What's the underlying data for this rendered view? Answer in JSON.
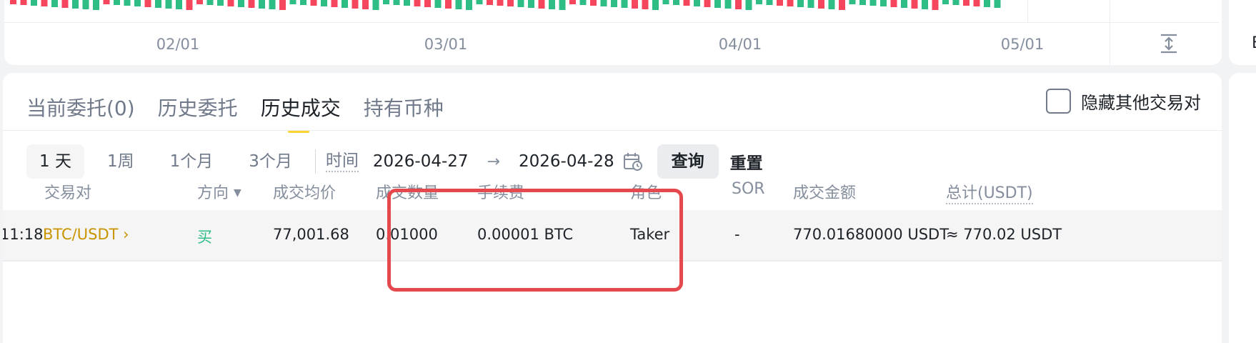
{
  "colors": {
    "up": "#2ebd85",
    "down": "#f6465d",
    "accent": "#fcd535",
    "pair_link": "#c99400",
    "highlight": "#e5484d"
  },
  "chart": {
    "x_ticks": [
      "02/01",
      "03/01",
      "04/01",
      "05/01"
    ],
    "expand_icon": "expand-vertical-icon"
  },
  "tabs": [
    {
      "label": "当前委托(0)",
      "active": false
    },
    {
      "label": "历史委托",
      "active": false
    },
    {
      "label": "历史成交",
      "active": true
    },
    {
      "label": "持有币种",
      "active": false
    }
  ],
  "hide_other_pairs": {
    "label": "隐藏其他交易对",
    "checked": false
  },
  "filter": {
    "periods": [
      {
        "label": "1 天",
        "active": true
      },
      {
        "label": "1周",
        "active": false
      },
      {
        "label": "1个月",
        "active": false
      },
      {
        "label": "3个月",
        "active": false
      }
    ],
    "time_label": "时间",
    "start_date": "2026-04-27",
    "arrow": "→",
    "end_date": "2026-04-28",
    "query_label": "查询",
    "reset_label": "重置"
  },
  "table": {
    "columns": {
      "pair": "交易对",
      "side": "方向",
      "avg_price": "成交均价",
      "qty": "成交数量",
      "fee": "手续费",
      "role": "角色",
      "sor": "SOR",
      "amount": "成交金额",
      "total": "总计(USDT)"
    },
    "rows": [
      {
        "time": "11:18",
        "pair": "BTC/USDT ›",
        "side": "买",
        "avg_price": "77,001.68",
        "qty": "0.01000",
        "fee": "0.00001 BTC",
        "role": "Taker",
        "sor": "-",
        "amount": "770.01680000 USDT",
        "total": "≈ 770.02 USDT"
      }
    ]
  },
  "right_panel": {
    "chars": [
      "B"
    ]
  }
}
